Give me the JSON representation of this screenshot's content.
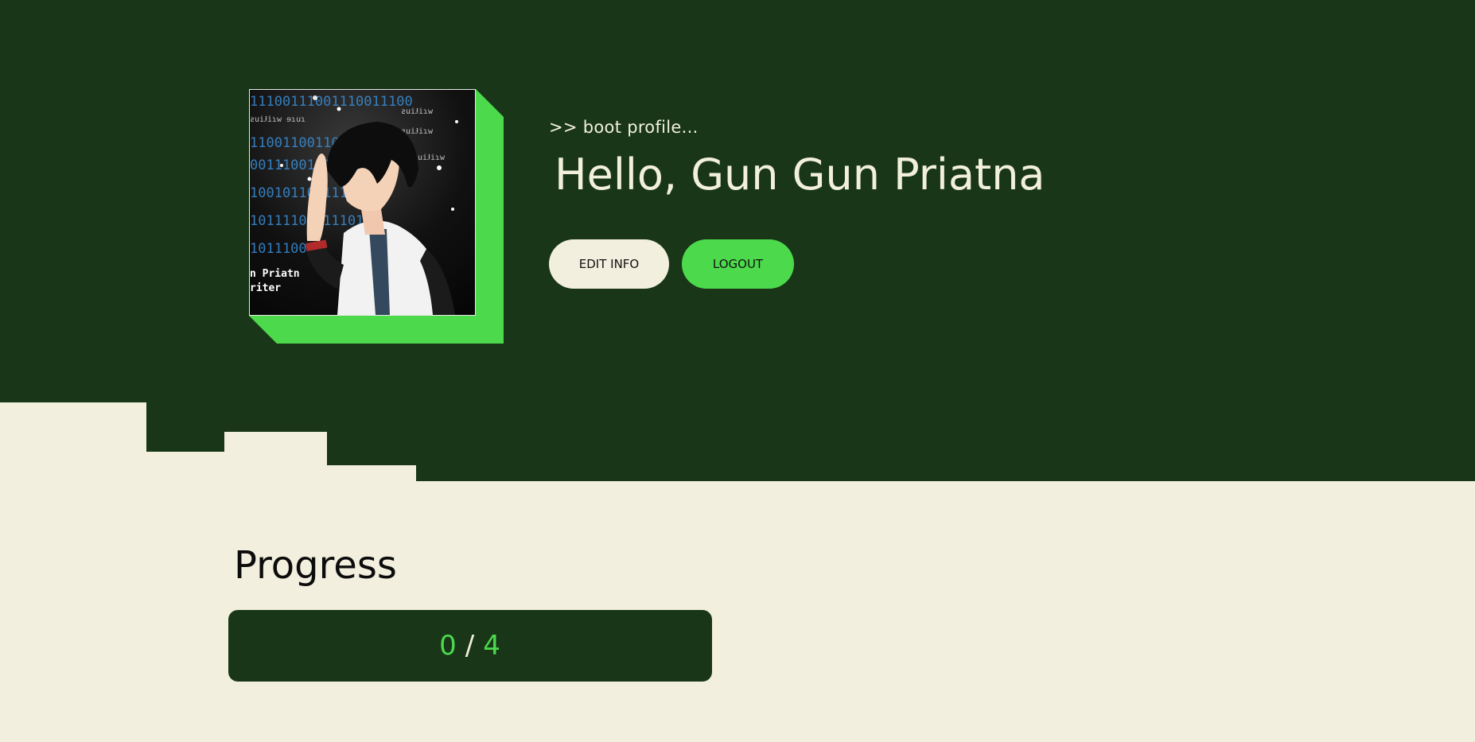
{
  "hero": {
    "boot_text": ">> boot profile...",
    "greeting": "Hello, Gun Gun Priatna",
    "edit_label": "EDIT INFO",
    "logout_label": "LOGOUT"
  },
  "avatar": {
    "icon": "profile-avatar-image",
    "caption_lines": [
      "n Priatn",
      "riter"
    ]
  },
  "progress": {
    "title": "Progress",
    "completed": "0",
    "separator": "/",
    "total": "4"
  },
  "colors": {
    "dark_green": "#193718",
    "accent_green": "#4cd94c",
    "cream": "#f2efdf"
  }
}
